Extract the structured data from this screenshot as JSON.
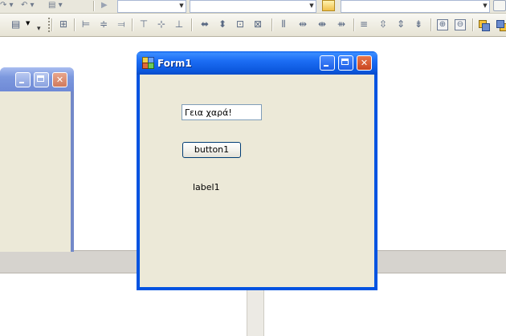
{
  "toolbar": {
    "row1_glyphs": [
      "↷ ▾",
      "↶ ▾",
      "▤ ▾",
      "▶"
    ],
    "row2_icons": [
      "align-left-icon",
      "align-center-icon",
      "align-right-icon",
      "align-top-icon",
      "align-middle-icon",
      "align-bottom-icon",
      "make-same-width-icon",
      "make-same-height-icon",
      "size-to-grid-icon",
      "make-same-size-icon",
      "horizontal-spacing-equal-icon",
      "horizontal-spacing-increase-icon",
      "horizontal-spacing-decrease-icon",
      "horizontal-spacing-remove-icon",
      "vertical-spacing-equal-icon",
      "vertical-spacing-increase-icon",
      "vertical-spacing-decrease-icon",
      "vertical-spacing-remove-icon",
      "center-horizontally-icon",
      "center-vertically-icon",
      "bring-to-front-icon",
      "send-to-back-icon"
    ]
  },
  "form1": {
    "title": "Form1",
    "textbox_value": "Γεια χαρά!",
    "button_label": "button1",
    "label_text": "label1"
  },
  "colors": {
    "xp_title_blue": "#0053e1",
    "client_beige": "#ece9d8",
    "close_red": "#c84520"
  }
}
